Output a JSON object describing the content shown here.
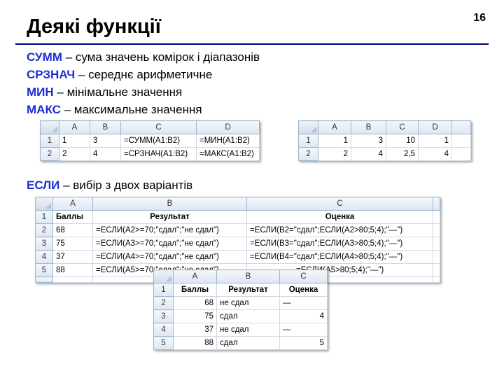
{
  "header": {
    "title": "Деякі функції",
    "page_number": "16"
  },
  "definitions": [
    {
      "keyword": "СУММ",
      "text": " – сума значень комірок і діапазонів"
    },
    {
      "keyword": "СРЗНАЧ",
      "text": " – середнє арифметичне"
    },
    {
      "keyword": "МИН",
      "text": " – мінімальне значення"
    },
    {
      "keyword": "МАКС",
      "text": " – максимальне значення"
    }
  ],
  "if_definition": {
    "keyword": "ЕСЛИ",
    "text": " – вибір з двох варіантів"
  },
  "sheet1": {
    "columns": [
      "A",
      "B",
      "C",
      "D"
    ],
    "rows": [
      {
        "n": "1",
        "cells": [
          "1",
          "3",
          "=СУММ(A1:B2)",
          "=МИН(A1:B2)"
        ]
      },
      {
        "n": "2",
        "cells": [
          "2",
          "4",
          "=СРЗНАЧ(A1:B2)",
          "=МАКС(A1:B2)"
        ]
      }
    ]
  },
  "sheet2": {
    "columns": [
      "A",
      "B",
      "C",
      "D"
    ],
    "rows": [
      {
        "n": "1",
        "cells": [
          "1",
          "3",
          "10",
          "1"
        ]
      },
      {
        "n": "2",
        "cells": [
          "2",
          "4",
          "2,5",
          "4"
        ]
      }
    ]
  },
  "sheet3": {
    "columns": [
      "A",
      "B",
      "C"
    ],
    "rows": [
      {
        "n": "1",
        "cells": [
          "Баллы",
          "Результат",
          "Оценка"
        ]
      },
      {
        "n": "2",
        "cells": [
          "68",
          "=ЕСЛИ(A2>=70;\"сдал\";\"не сдал\")",
          "=ЕСЛИ(B2=\"сдал\";ЕСЛИ(A2>80;5;4);\"—\")"
        ]
      },
      {
        "n": "3",
        "cells": [
          "75",
          "=ЕСЛИ(A3>=70;\"сдал\";\"не сдал\")",
          "=ЕСЛИ(B3=\"сдал\";ЕСЛИ(A3>80;5;4);\"—\")"
        ]
      },
      {
        "n": "4",
        "cells": [
          "37",
          "=ЕСЛИ(A4>=70;\"сдал\";\"не сдал\")",
          "=ЕСЛИ(B4=\"сдал\";ЕСЛИ(A4>80;5;4);\"—\")"
        ]
      },
      {
        "n": "5",
        "cells": [
          "88",
          "=ЕСЛИ(A5>=70;\"сдал\";\"не сдал\")",
          "=ЕСЛИ(A5>80;5;4);\"—\")"
        ]
      }
    ]
  },
  "sheet4": {
    "columns": [
      "A",
      "B",
      "C"
    ],
    "rows": [
      {
        "n": "1",
        "cells": [
          "Баллы",
          "Результат",
          "Оценка"
        ]
      },
      {
        "n": "2",
        "cells": [
          "68",
          "не сдал",
          "—"
        ]
      },
      {
        "n": "3",
        "cells": [
          "75",
          "сдал",
          "4"
        ]
      },
      {
        "n": "4",
        "cells": [
          "37",
          "не сдал",
          "—"
        ]
      },
      {
        "n": "5",
        "cells": [
          "88",
          "сдал",
          "5"
        ]
      }
    ]
  },
  "colors": {
    "keyword": "#1c2fd1",
    "rule": "#00008b"
  }
}
